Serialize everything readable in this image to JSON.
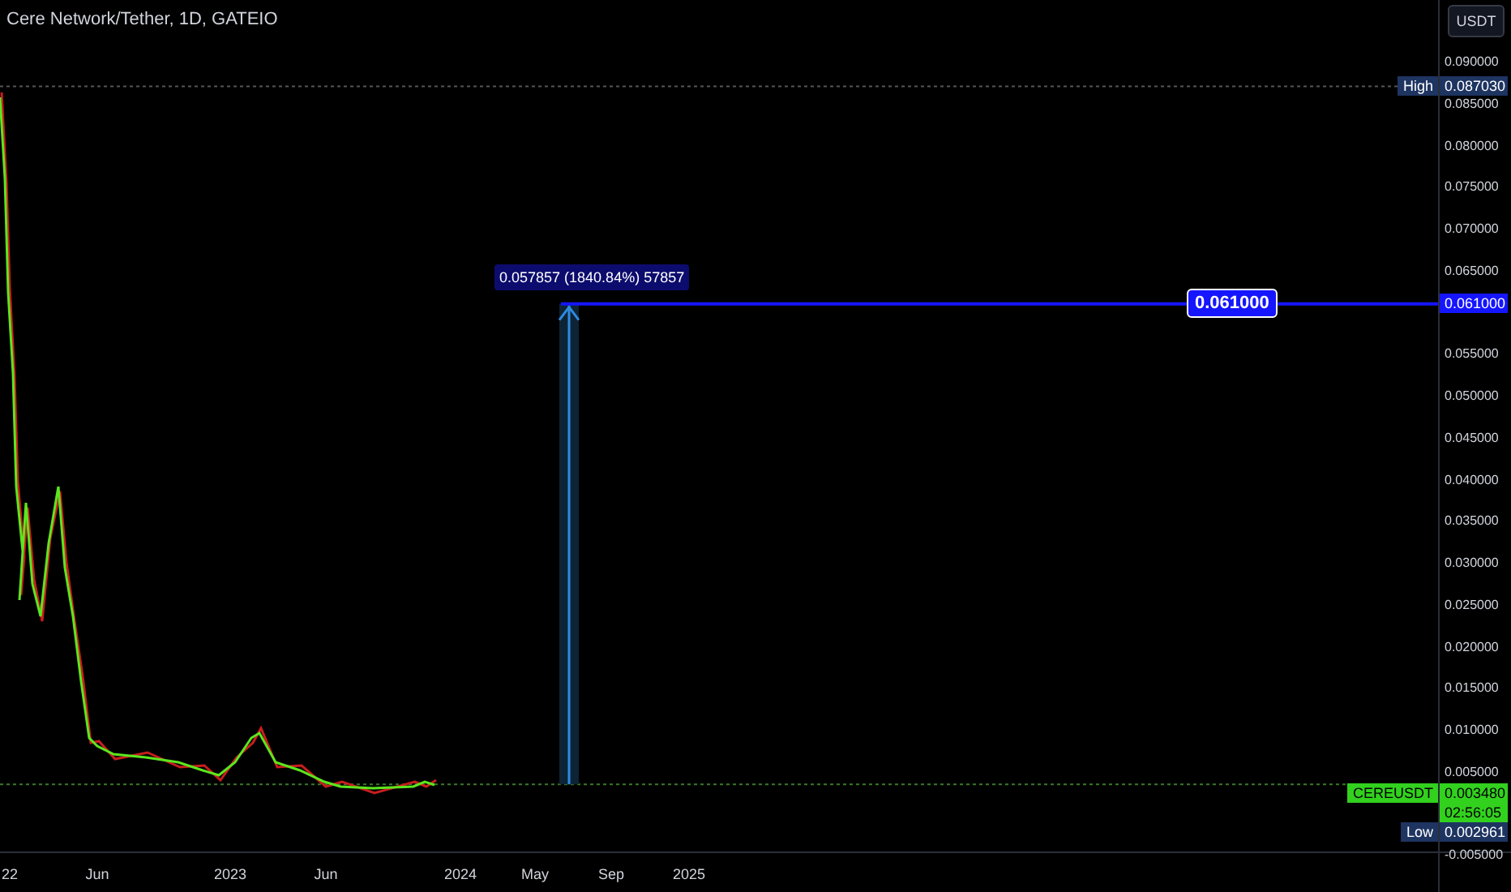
{
  "header": {
    "title": "Cere Network/Tether, 1D, GATEIO"
  },
  "currency_button": "USDT",
  "price_axis": {
    "ticks": [
      "0.090000",
      "0.085000",
      "0.080000",
      "0.075000",
      "0.070000",
      "0.065000",
      "0.055000",
      "0.050000",
      "0.045000",
      "0.040000",
      "0.035000",
      "0.030000",
      "0.025000",
      "0.020000",
      "0.015000",
      "0.010000",
      "0.005000",
      "-0.005000"
    ]
  },
  "time_axis": {
    "labels": [
      "22",
      "Jun",
      "2023",
      "Jun",
      "2024",
      "May",
      "Sep",
      "2025"
    ]
  },
  "high_marker": {
    "label": "High",
    "value": "0.087030"
  },
  "horizontal_line": {
    "value": "0.061000",
    "axis_value": "0.061000"
  },
  "measure_tool": {
    "label": "0.057857 (1840.84%) 57857"
  },
  "last_price": {
    "symbol": "CEREUSDT",
    "value": "0.003480",
    "countdown": "02:56:05"
  },
  "low_marker": {
    "label": "Low",
    "value": "0.002961"
  }
}
